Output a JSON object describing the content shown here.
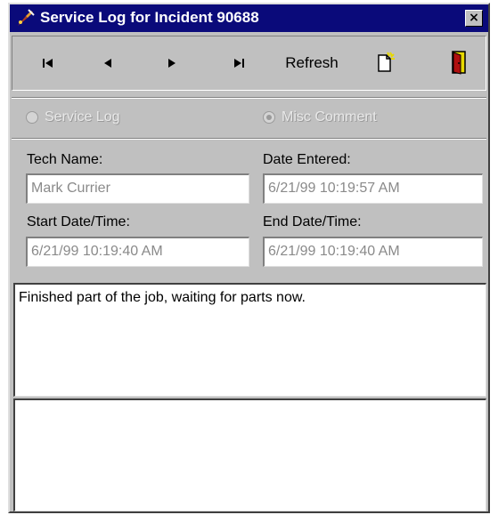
{
  "window": {
    "title": "Service Log for Incident 90688",
    "close_label": "×"
  },
  "toolbar": {
    "first_icon": "first-record-icon",
    "prev_icon": "previous-record-icon",
    "next_icon": "next-record-icon",
    "last_icon": "last-record-icon",
    "refresh_label": "Refresh",
    "new_icon": "new-document-icon",
    "exit_icon": "exit-door-icon"
  },
  "entry_type": {
    "options": [
      {
        "label": "Service Log",
        "selected": false,
        "enabled": false
      },
      {
        "label": "Misc Comment",
        "selected": true,
        "enabled": false
      }
    ]
  },
  "fields": {
    "tech_name": {
      "label": "Tech Name:",
      "value": "Mark Currier"
    },
    "date_entered": {
      "label": "Date Entered:",
      "value": "6/21/99 10:19:57 AM"
    },
    "start": {
      "label": "Start Date/Time:",
      "value": "6/21/99 10:19:40 AM"
    },
    "end": {
      "label": "End Date/Time:",
      "value": "6/21/99 10:19:40 AM"
    }
  },
  "comment": {
    "text": "Finished part of the job, waiting for parts now.",
    "extra_text": ""
  },
  "colors": {
    "titlebar": "#0a0a7a",
    "window_face": "#c0c0c0",
    "disabled_text": "#8a8a8a"
  }
}
